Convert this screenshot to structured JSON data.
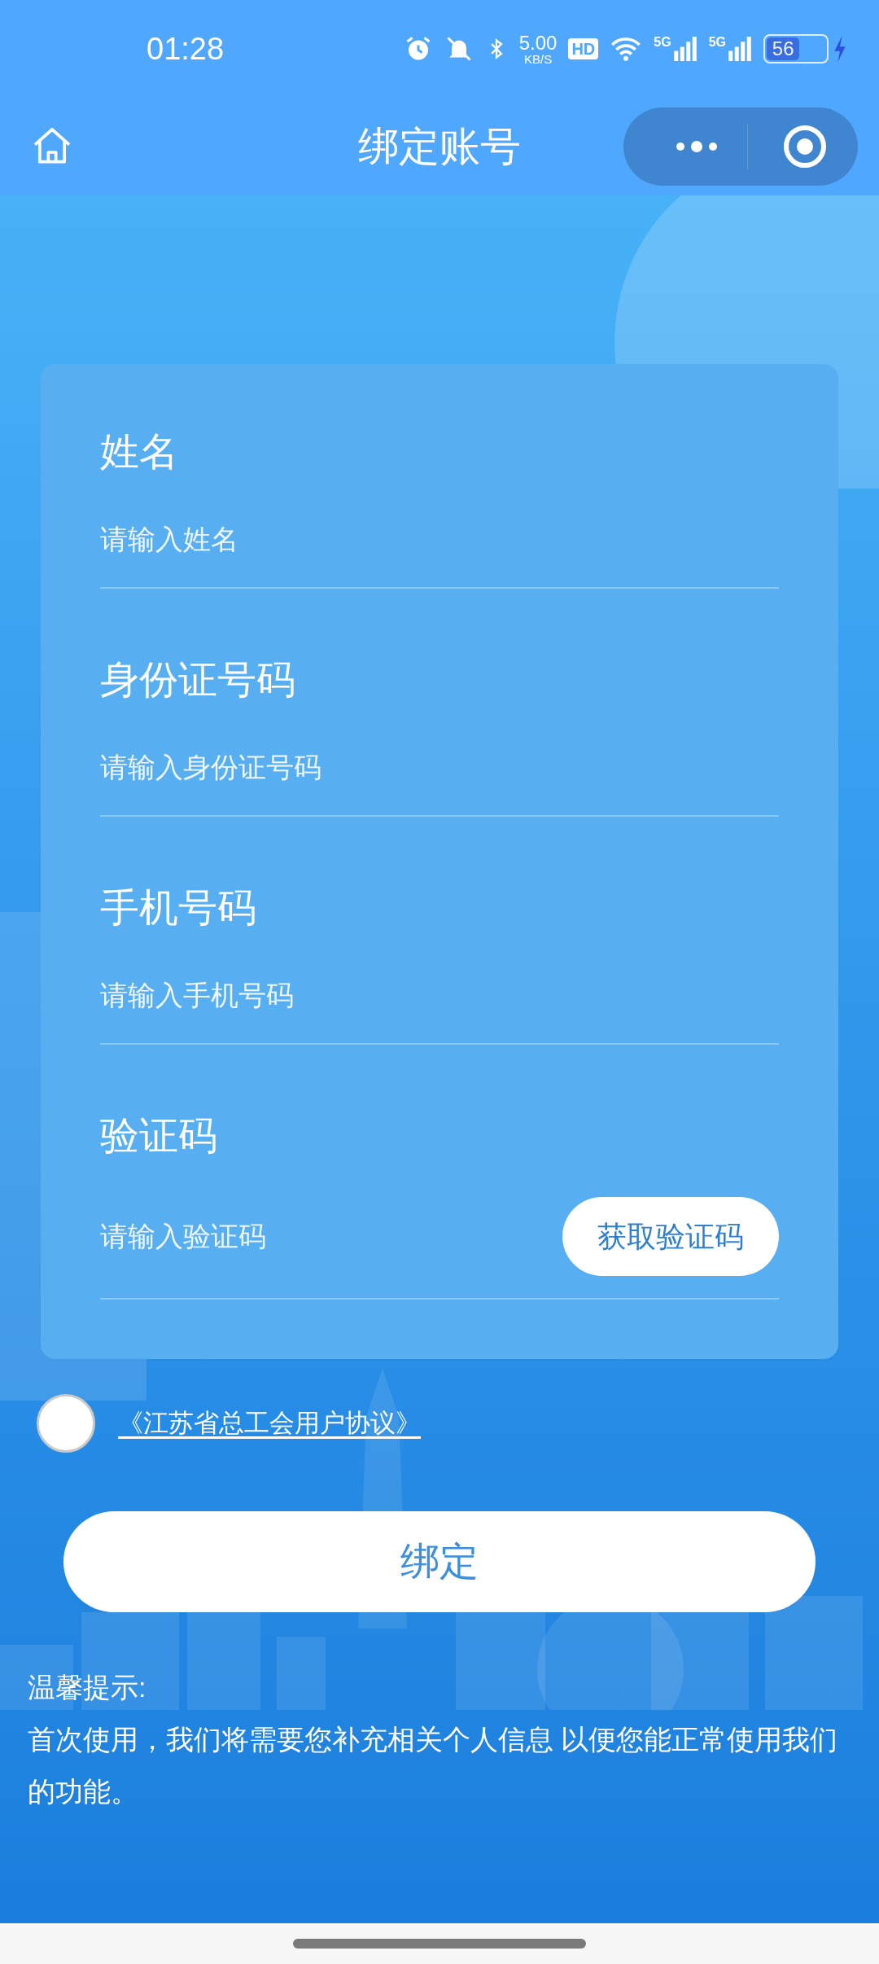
{
  "status_bar": {
    "time": "01:28",
    "net_speed": "5.00",
    "net_unit": "KB/S",
    "hd": "HD",
    "signals": [
      "5G",
      "5G"
    ],
    "battery": "56",
    "charging": true
  },
  "nav": {
    "title": "绑定账号"
  },
  "form": {
    "fields": [
      {
        "kind": "text",
        "label": "姓名",
        "placeholder": "请输入姓名"
      },
      {
        "kind": "text",
        "label": "身份证号码",
        "placeholder": "请输入身份证号码"
      },
      {
        "kind": "text",
        "label": "手机号码",
        "placeholder": "请输入手机号码"
      },
      {
        "kind": "code",
        "label": "验证码",
        "placeholder": "请输入验证码",
        "button": "获取验证码"
      }
    ]
  },
  "agreement": {
    "checked": false,
    "link": "《江苏省总工会用户协议》"
  },
  "submit": "绑定",
  "notice": {
    "title": "温馨提示:",
    "body": "首次使用，我们将需要您补充相关个人信息 以便您能正常使用我们的功能。"
  }
}
